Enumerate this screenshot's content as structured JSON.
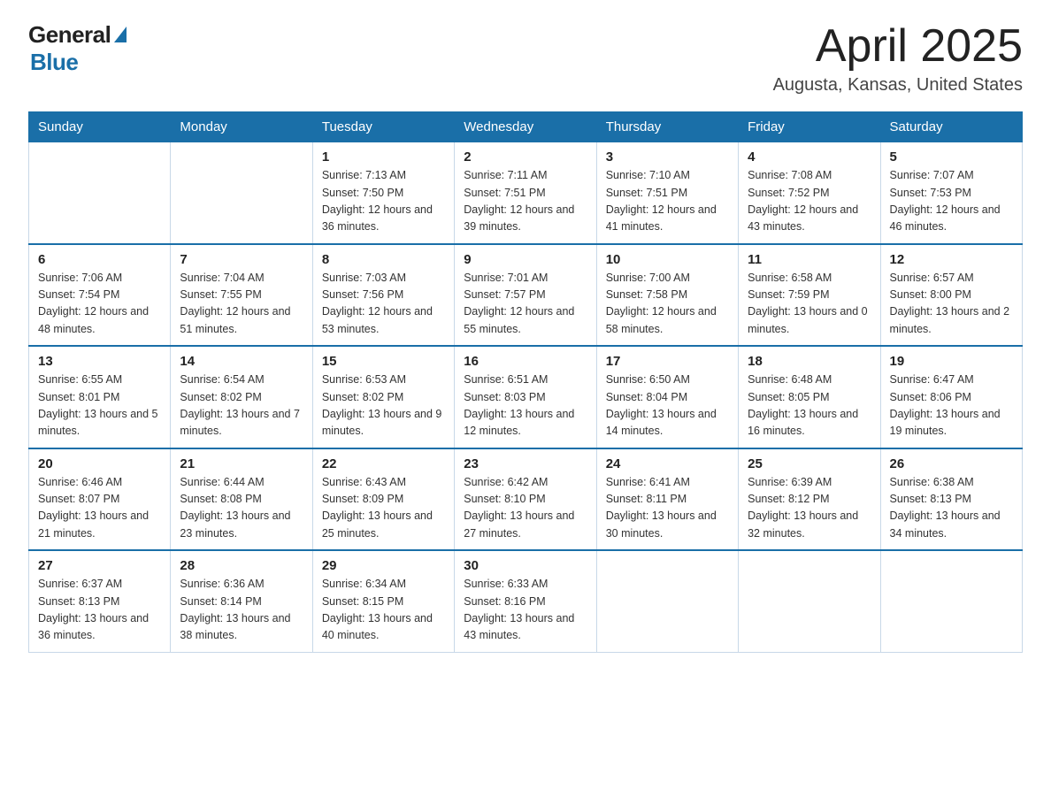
{
  "header": {
    "logo_general": "General",
    "logo_blue": "Blue",
    "month": "April 2025",
    "location": "Augusta, Kansas, United States"
  },
  "days_of_week": [
    "Sunday",
    "Monday",
    "Tuesday",
    "Wednesday",
    "Thursday",
    "Friday",
    "Saturday"
  ],
  "weeks": [
    [
      {
        "day": "",
        "sunrise": "",
        "sunset": "",
        "daylight": ""
      },
      {
        "day": "",
        "sunrise": "",
        "sunset": "",
        "daylight": ""
      },
      {
        "day": "1",
        "sunrise": "Sunrise: 7:13 AM",
        "sunset": "Sunset: 7:50 PM",
        "daylight": "Daylight: 12 hours and 36 minutes."
      },
      {
        "day": "2",
        "sunrise": "Sunrise: 7:11 AM",
        "sunset": "Sunset: 7:51 PM",
        "daylight": "Daylight: 12 hours and 39 minutes."
      },
      {
        "day": "3",
        "sunrise": "Sunrise: 7:10 AM",
        "sunset": "Sunset: 7:51 PM",
        "daylight": "Daylight: 12 hours and 41 minutes."
      },
      {
        "day": "4",
        "sunrise": "Sunrise: 7:08 AM",
        "sunset": "Sunset: 7:52 PM",
        "daylight": "Daylight: 12 hours and 43 minutes."
      },
      {
        "day": "5",
        "sunrise": "Sunrise: 7:07 AM",
        "sunset": "Sunset: 7:53 PM",
        "daylight": "Daylight: 12 hours and 46 minutes."
      }
    ],
    [
      {
        "day": "6",
        "sunrise": "Sunrise: 7:06 AM",
        "sunset": "Sunset: 7:54 PM",
        "daylight": "Daylight: 12 hours and 48 minutes."
      },
      {
        "day": "7",
        "sunrise": "Sunrise: 7:04 AM",
        "sunset": "Sunset: 7:55 PM",
        "daylight": "Daylight: 12 hours and 51 minutes."
      },
      {
        "day": "8",
        "sunrise": "Sunrise: 7:03 AM",
        "sunset": "Sunset: 7:56 PM",
        "daylight": "Daylight: 12 hours and 53 minutes."
      },
      {
        "day": "9",
        "sunrise": "Sunrise: 7:01 AM",
        "sunset": "Sunset: 7:57 PM",
        "daylight": "Daylight: 12 hours and 55 minutes."
      },
      {
        "day": "10",
        "sunrise": "Sunrise: 7:00 AM",
        "sunset": "Sunset: 7:58 PM",
        "daylight": "Daylight: 12 hours and 58 minutes."
      },
      {
        "day": "11",
        "sunrise": "Sunrise: 6:58 AM",
        "sunset": "Sunset: 7:59 PM",
        "daylight": "Daylight: 13 hours and 0 minutes."
      },
      {
        "day": "12",
        "sunrise": "Sunrise: 6:57 AM",
        "sunset": "Sunset: 8:00 PM",
        "daylight": "Daylight: 13 hours and 2 minutes."
      }
    ],
    [
      {
        "day": "13",
        "sunrise": "Sunrise: 6:55 AM",
        "sunset": "Sunset: 8:01 PM",
        "daylight": "Daylight: 13 hours and 5 minutes."
      },
      {
        "day": "14",
        "sunrise": "Sunrise: 6:54 AM",
        "sunset": "Sunset: 8:02 PM",
        "daylight": "Daylight: 13 hours and 7 minutes."
      },
      {
        "day": "15",
        "sunrise": "Sunrise: 6:53 AM",
        "sunset": "Sunset: 8:02 PM",
        "daylight": "Daylight: 13 hours and 9 minutes."
      },
      {
        "day": "16",
        "sunrise": "Sunrise: 6:51 AM",
        "sunset": "Sunset: 8:03 PM",
        "daylight": "Daylight: 13 hours and 12 minutes."
      },
      {
        "day": "17",
        "sunrise": "Sunrise: 6:50 AM",
        "sunset": "Sunset: 8:04 PM",
        "daylight": "Daylight: 13 hours and 14 minutes."
      },
      {
        "day": "18",
        "sunrise": "Sunrise: 6:48 AM",
        "sunset": "Sunset: 8:05 PM",
        "daylight": "Daylight: 13 hours and 16 minutes."
      },
      {
        "day": "19",
        "sunrise": "Sunrise: 6:47 AM",
        "sunset": "Sunset: 8:06 PM",
        "daylight": "Daylight: 13 hours and 19 minutes."
      }
    ],
    [
      {
        "day": "20",
        "sunrise": "Sunrise: 6:46 AM",
        "sunset": "Sunset: 8:07 PM",
        "daylight": "Daylight: 13 hours and 21 minutes."
      },
      {
        "day": "21",
        "sunrise": "Sunrise: 6:44 AM",
        "sunset": "Sunset: 8:08 PM",
        "daylight": "Daylight: 13 hours and 23 minutes."
      },
      {
        "day": "22",
        "sunrise": "Sunrise: 6:43 AM",
        "sunset": "Sunset: 8:09 PM",
        "daylight": "Daylight: 13 hours and 25 minutes."
      },
      {
        "day": "23",
        "sunrise": "Sunrise: 6:42 AM",
        "sunset": "Sunset: 8:10 PM",
        "daylight": "Daylight: 13 hours and 27 minutes."
      },
      {
        "day": "24",
        "sunrise": "Sunrise: 6:41 AM",
        "sunset": "Sunset: 8:11 PM",
        "daylight": "Daylight: 13 hours and 30 minutes."
      },
      {
        "day": "25",
        "sunrise": "Sunrise: 6:39 AM",
        "sunset": "Sunset: 8:12 PM",
        "daylight": "Daylight: 13 hours and 32 minutes."
      },
      {
        "day": "26",
        "sunrise": "Sunrise: 6:38 AM",
        "sunset": "Sunset: 8:13 PM",
        "daylight": "Daylight: 13 hours and 34 minutes."
      }
    ],
    [
      {
        "day": "27",
        "sunrise": "Sunrise: 6:37 AM",
        "sunset": "Sunset: 8:13 PM",
        "daylight": "Daylight: 13 hours and 36 minutes."
      },
      {
        "day": "28",
        "sunrise": "Sunrise: 6:36 AM",
        "sunset": "Sunset: 8:14 PM",
        "daylight": "Daylight: 13 hours and 38 minutes."
      },
      {
        "day": "29",
        "sunrise": "Sunrise: 6:34 AM",
        "sunset": "Sunset: 8:15 PM",
        "daylight": "Daylight: 13 hours and 40 minutes."
      },
      {
        "day": "30",
        "sunrise": "Sunrise: 6:33 AM",
        "sunset": "Sunset: 8:16 PM",
        "daylight": "Daylight: 13 hours and 43 minutes."
      },
      {
        "day": "",
        "sunrise": "",
        "sunset": "",
        "daylight": ""
      },
      {
        "day": "",
        "sunrise": "",
        "sunset": "",
        "daylight": ""
      },
      {
        "day": "",
        "sunrise": "",
        "sunset": "",
        "daylight": ""
      }
    ]
  ]
}
